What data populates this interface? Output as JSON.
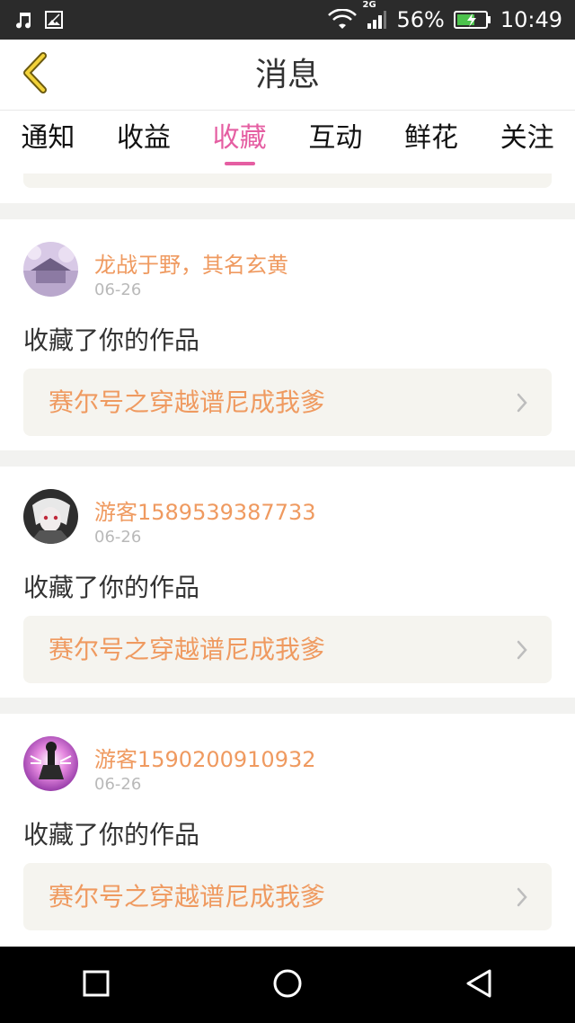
{
  "status_bar": {
    "icons_left": [
      "music-icon",
      "image-icon"
    ],
    "network": "2G",
    "battery": "56%",
    "time": "10:49"
  },
  "header": {
    "title": "消息"
  },
  "tabs": [
    {
      "label": "通知",
      "active": false
    },
    {
      "label": "收益",
      "active": false
    },
    {
      "label": "收藏",
      "active": true
    },
    {
      "label": "互动",
      "active": false
    },
    {
      "label": "鲜花",
      "active": false
    },
    {
      "label": "关注",
      "active": false
    }
  ],
  "colors": {
    "accent": "#e55ea2",
    "orange": "#ef9a60",
    "card_box": "#f5f4ef"
  },
  "feed": [
    {
      "user": "龙战于野，其名玄黄",
      "date": "06-26",
      "action": "收藏了你的作品",
      "work": "赛尔号之穿越谱尼成我爹"
    },
    {
      "user": "游客1589539387733",
      "date": "06-26",
      "action": "收藏了你的作品",
      "work": "赛尔号之穿越谱尼成我爹"
    },
    {
      "user": "游客1590200910932",
      "date": "06-26",
      "action": "收藏了你的作品",
      "work": "赛尔号之穿越谱尼成我爹"
    }
  ]
}
